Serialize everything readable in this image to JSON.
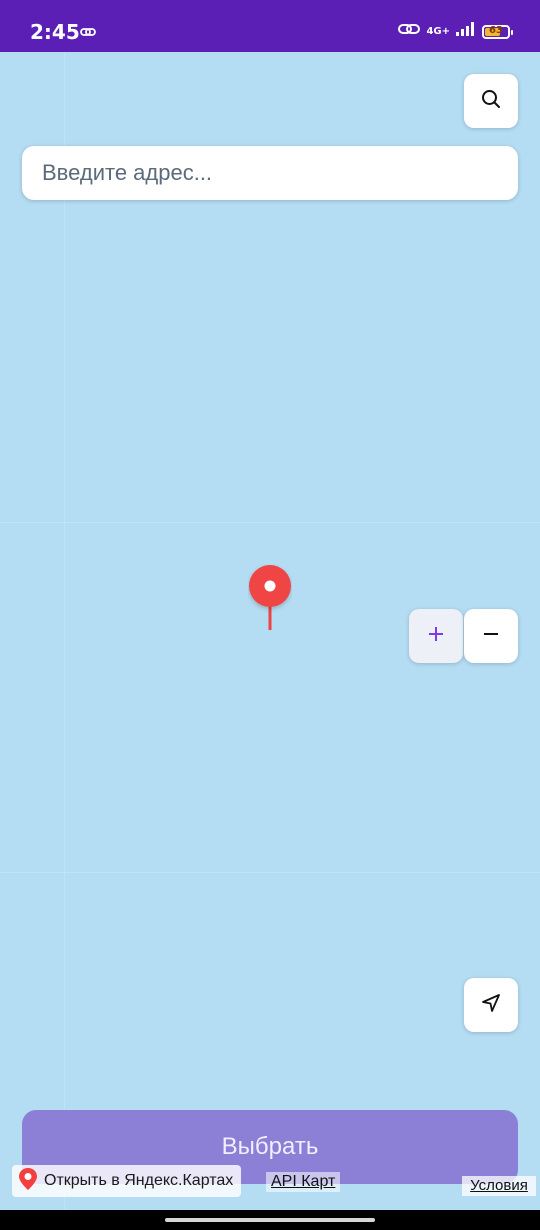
{
  "status_bar": {
    "time": "2:45",
    "network": "4G+",
    "battery_level": "63",
    "battery_color": "#f2b53a",
    "background": "#5b1fb5"
  },
  "map": {
    "background": "#b4dcf2",
    "search_button_icon": "search-icon",
    "address_placeholder": "Введите адрес...",
    "zoom_in_label": "+",
    "zoom_out_label": "−",
    "locate_icon": "navigation-arrow-icon",
    "pin_color": "#ef4444"
  },
  "actions": {
    "select_label": "Выбрать"
  },
  "attribution": {
    "open_in_yandex": "Открыть в Яндекс.Картах",
    "api_link": "API Карт",
    "terms_link": "Условия"
  }
}
